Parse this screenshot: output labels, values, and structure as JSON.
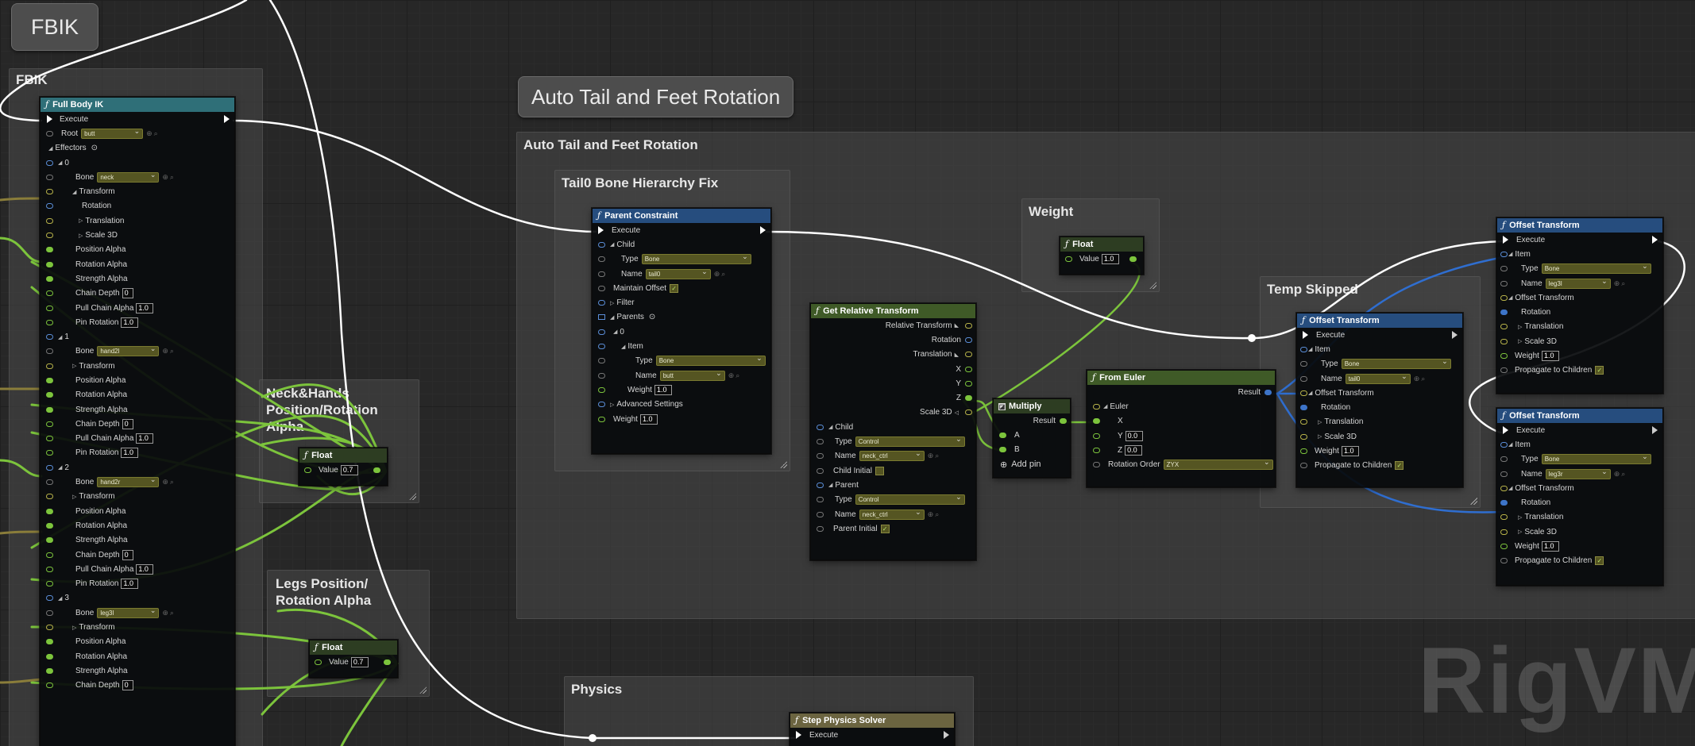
{
  "bubbles": {
    "fbik": "FBIK",
    "auto": "Auto Tail and Feet Rotation"
  },
  "comments": {
    "fbik": "FBIK",
    "auto": "Auto Tail and Feet Rotation",
    "tail0": "Tail0 Bone Hierarchy Fix",
    "weight": "Weight",
    "temp": "Temp Skipped",
    "neck": "Neck&Hands Position/Rotation Alpha",
    "legs": "Legs Position/ Rotation Alpha",
    "physics": "Physics"
  },
  "full_body_ik": {
    "title": "Full Body IK",
    "execute": "Execute",
    "root_label": "Root",
    "root_value": "butt",
    "effectors": "Effectors",
    "bone": "Bone",
    "transform": "Transform",
    "rotation": "Rotation",
    "translation": "Translation",
    "scale3d": "Scale 3D",
    "position_alpha": "Position Alpha",
    "rotation_alpha": "Rotation Alpha",
    "strength_alpha": "Strength Alpha",
    "chain_depth": "Chain Depth",
    "pull_chain_alpha": "Pull Chain Alpha",
    "pin_rotation": "Pin Rotation",
    "effector_items": [
      {
        "index": "0",
        "bone": "neck",
        "chain_depth": "0",
        "pull": "1.0",
        "pin": "1.0"
      },
      {
        "index": "1",
        "bone": "hand2l",
        "chain_depth": "0",
        "pull": "1.0",
        "pin": "1.0"
      },
      {
        "index": "2",
        "bone": "hand2r",
        "chain_depth": "0",
        "pull": "1.0",
        "pin": "1.0"
      },
      {
        "index": "3",
        "bone": "leg3l",
        "chain_depth": "0"
      }
    ]
  },
  "float_neck": {
    "title": "Float",
    "label": "Value",
    "value": "0.7"
  },
  "float_legs": {
    "title": "Float",
    "label": "Value",
    "value": "0.7"
  },
  "float_weight": {
    "title": "Float",
    "label": "Value",
    "value": "1.0"
  },
  "parent_constraint": {
    "title": "Parent Constraint",
    "execute": "Execute",
    "child": "Child",
    "type": "Type",
    "type_value": "Bone",
    "name": "Name",
    "name_value": "tail0",
    "maintain_offset": "Maintain Offset",
    "filter": "Filter",
    "parents": "Parents",
    "index0": "0",
    "item": "Item",
    "item_type_value": "Bone",
    "item_name_value": "butt",
    "weight": "Weight",
    "weight_value": "1.0",
    "advanced": "Advanced Settings",
    "weight2_value": "1.0"
  },
  "get_relative": {
    "title": "Get Relative Transform",
    "relative_transform": "Relative Transform",
    "rotation": "Rotation",
    "translation": "Translation",
    "x": "X",
    "y": "Y",
    "z": "Z",
    "scale3d": "Scale 3D",
    "child": "Child",
    "type": "Type",
    "child_type_value": "Control",
    "name": "Name",
    "child_name_value": "neck_ctrl",
    "child_initial": "Child Initial",
    "parent": "Parent",
    "parent_type_value": "Control",
    "parent_name_value": "neck_ctrl",
    "parent_initial": "Parent Initial"
  },
  "multiply": {
    "title": "Multiply",
    "result": "Result",
    "a": "A",
    "b": "B",
    "add_pin": "Add pin"
  },
  "from_euler": {
    "title": "From Euler",
    "result": "Result",
    "euler": "Euler",
    "x": "X",
    "y": "Y",
    "y_value": "0.0",
    "z": "Z",
    "z_value": "0.0",
    "rotation_order": "Rotation Order",
    "rotation_order_value": "ZYX"
  },
  "offset_temp": {
    "title": "Offset Transform",
    "execute": "Execute",
    "item": "Item",
    "type": "Type",
    "type_value": "Bone",
    "name": "Name",
    "name_value": "tail0",
    "offset_transform": "Offset Transform",
    "rotation": "Rotation",
    "translation": "Translation",
    "scale3d": "Scale 3D",
    "weight": "Weight",
    "weight_value": "1.0",
    "propagate": "Propagate to Children"
  },
  "offset_l": {
    "title": "Offset Transform",
    "execute": "Execute",
    "item": "Item",
    "type": "Type",
    "type_value": "Bone",
    "name": "Name",
    "name_value": "leg3l",
    "offset_transform": "Offset Transform",
    "rotation": "Rotation",
    "translation": "Translation",
    "scale3d": "Scale 3D",
    "weight": "Weight",
    "weight_value": "1.0",
    "propagate": "Propagate to Children"
  },
  "offset_r": {
    "title": "Offset Transform",
    "execute": "Execute",
    "item": "Item",
    "type": "Type",
    "type_value": "Bone",
    "name": "Name",
    "name_value": "leg3r",
    "offset_transform": "Offset Transform",
    "rotation": "Rotation",
    "translation": "Translation",
    "scale3d": "Scale 3D",
    "weight": "Weight",
    "weight_value": "1.0",
    "propagate": "Propagate to Children"
  },
  "step_physics": {
    "title": "Step Physics Solver",
    "execute": "Execute"
  },
  "watermark": "RigVM",
  "colors": {
    "header_teal": "#2f6f78",
    "header_blue": "#264d7e",
    "header_green": "#3f5a27",
    "header_olive": "#6b6440",
    "wire_exec": "#ffffff",
    "wire_float": "#7cc43c",
    "wire_transform": "#2f6ed0"
  }
}
